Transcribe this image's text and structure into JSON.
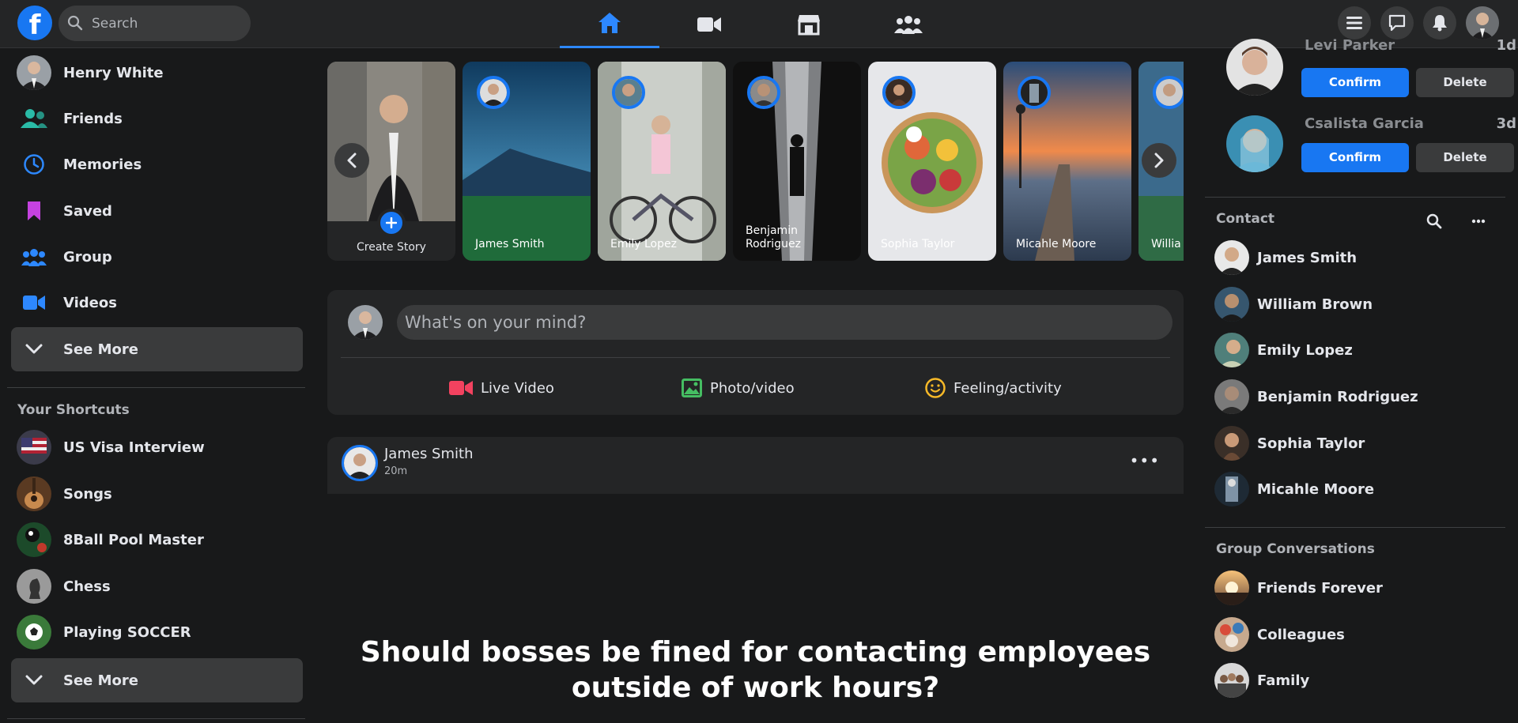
{
  "topbar": {
    "logo_letter": "f",
    "search_placeholder": "Search",
    "nav": [
      "home-icon",
      "video-icon",
      "marketplace-icon",
      "groups-icon"
    ],
    "right_buttons": [
      "menu-icon",
      "messenger-icon",
      "notifications-icon"
    ]
  },
  "sidebar": {
    "profile_name": "Henry White",
    "items": [
      {
        "label": "Friends",
        "icon": "friends-icon",
        "color": "#2abba7"
      },
      {
        "label": "Memories",
        "icon": "clock-icon",
        "color": "#2d88ff"
      },
      {
        "label": "Saved",
        "icon": "bookmark-icon",
        "color": "#c542e0"
      },
      {
        "label": "Group",
        "icon": "group-icon",
        "color": "#2d88ff"
      },
      {
        "label": "Videos",
        "icon": "video-icon",
        "color": "#2d88ff"
      }
    ],
    "see_more_label": "See More",
    "shortcuts_title": "Your Shortcuts",
    "shortcuts": [
      {
        "label": "US Visa Interview"
      },
      {
        "label": "Songs"
      },
      {
        "label": "8Ball Pool Master"
      },
      {
        "label": "Chess"
      },
      {
        "label": "Playing SOCCER"
      }
    ],
    "see_more_label_2": "See More"
  },
  "stories": {
    "create_label": "Create Story",
    "items": [
      {
        "name": "James Smith"
      },
      {
        "name": "Emily Lopez"
      },
      {
        "name": "Benjamin Rodriguez"
      },
      {
        "name": "Sophia Taylor"
      },
      {
        "name": "Micahle Moore"
      },
      {
        "name": "Willia"
      }
    ]
  },
  "composer": {
    "placeholder": "What's on your mind?",
    "actions": [
      {
        "label": "Live Video",
        "icon": "live-video-icon",
        "color": "#f3425f"
      },
      {
        "label": "Photo/video",
        "icon": "photo-icon",
        "color": "#45bd62"
      },
      {
        "label": "Feeling/activity",
        "icon": "feeling-icon",
        "color": "#f7b928"
      }
    ]
  },
  "post": {
    "author": "James Smith",
    "time": "20m",
    "more": "•••",
    "headline": "Should bosses be fined for contacting employees outside of work hours?"
  },
  "friend_requests": [
    {
      "name": "Levi Parker",
      "time": "1d",
      "confirm": "Confirm",
      "delete": "Delete"
    },
    {
      "name": "Csalista Garcia",
      "time": "3d",
      "confirm": "Confirm",
      "delete": "Delete"
    }
  ],
  "contacts": {
    "title": "Contact",
    "items": [
      {
        "name": "James Smith"
      },
      {
        "name": "William Brown"
      },
      {
        "name": "Emily Lopez"
      },
      {
        "name": "Benjamin Rodriguez"
      },
      {
        "name": "Sophia Taylor"
      },
      {
        "name": "Micahle Moore"
      }
    ]
  },
  "groups": {
    "title": "Group Conversations",
    "items": [
      {
        "name": "Friends Forever"
      },
      {
        "name": "Colleagues"
      },
      {
        "name": "Family"
      }
    ]
  }
}
